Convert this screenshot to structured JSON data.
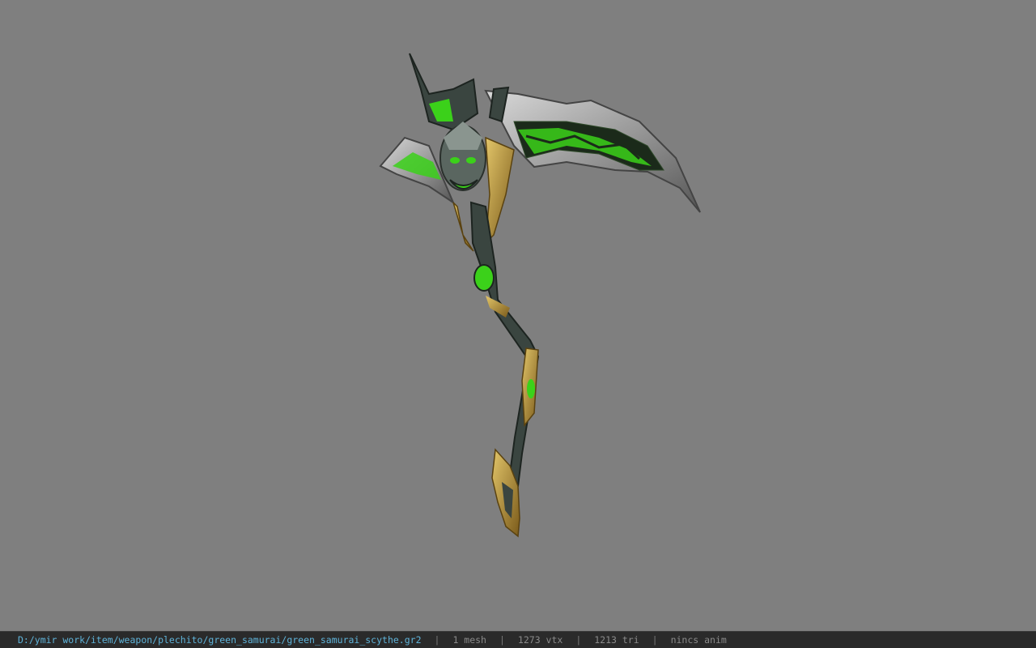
{
  "viewer": {
    "background_color": "#7f7f7f",
    "model_description_icon": "scythe-model"
  },
  "status": {
    "file_path": "D:/ymir work/item/weapon/plechito/green_samurai/green_samurai_scythe.gr2",
    "separator": "|",
    "mesh": "1 mesh",
    "vertices": "1273 vtx",
    "triangles": "1213 tri",
    "animation": "nincs anim",
    "path_color": "#5fb3d9",
    "text_color": "#8a8a8a"
  }
}
